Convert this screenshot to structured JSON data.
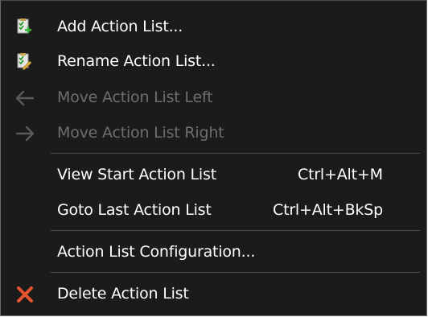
{
  "menu": {
    "items": [
      {
        "label": "Add Action List...",
        "icon": "add-list-icon",
        "enabled": true
      },
      {
        "label": "Rename Action List...",
        "icon": "rename-list-icon",
        "enabled": true
      },
      {
        "label": "Move Action List Left",
        "icon": "arrow-left-icon",
        "enabled": false
      },
      {
        "label": "Move Action List Right",
        "icon": "arrow-right-icon",
        "enabled": false
      },
      {
        "label": "View Start Action List",
        "shortcut": "Ctrl+Alt+M",
        "enabled": true
      },
      {
        "label": "Goto Last Action List",
        "shortcut": "Ctrl+Alt+BkSp",
        "enabled": true
      },
      {
        "label": "Action List Configuration...",
        "enabled": true
      },
      {
        "label": "Delete Action List",
        "icon": "delete-x-icon",
        "enabled": true
      }
    ]
  },
  "colors": {
    "background": "#1b1b1b",
    "text": "#ffffff",
    "disabled_text": "#6e6e6e",
    "separator": "#4e4e4e",
    "delete_icon": "#e8542f",
    "check_icon": "#2e9b2e"
  }
}
